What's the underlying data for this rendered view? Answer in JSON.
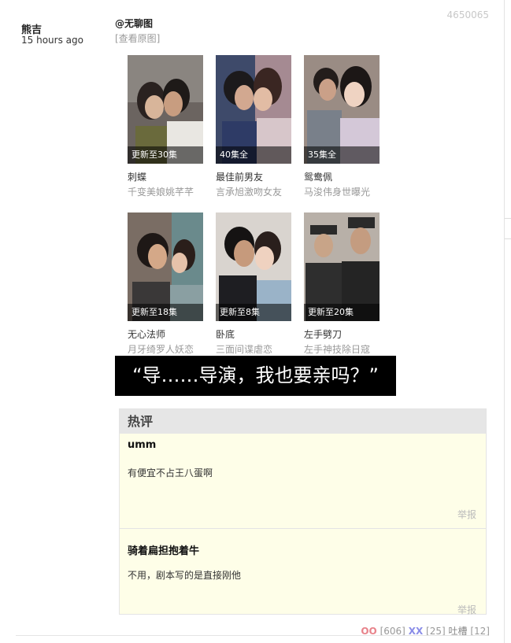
{
  "post": {
    "author": "熊吉",
    "time": "15 hours ago",
    "id": "4650065",
    "mention": "@无聊图",
    "view_original": "[查看原图]"
  },
  "image": {
    "cards": [
      {
        "badge": "更新至30集",
        "title": "刺蝶",
        "subtitle": "千变美娘姚芊芊"
      },
      {
        "badge": "40集全",
        "title": "最佳前男友",
        "subtitle": "言承旭激吻女友"
      },
      {
        "badge": "35集全",
        "title": "鸳鸯佩",
        "subtitle": "马浚伟身世曝光"
      },
      {
        "badge": "更新至18集",
        "title": "无心法师",
        "subtitle": "月牙绮罗人妖恋"
      },
      {
        "badge": "更新至8集",
        "title": "卧底",
        "subtitle": "三面间谍虐恋"
      },
      {
        "badge": "更新至20集",
        "title": "左手劈刀",
        "subtitle": "左手神技除日寇"
      }
    ],
    "caption": "“导……导演，我也要亲吗？”"
  },
  "hot_comments": {
    "title": "热评",
    "items": [
      {
        "user": "umm",
        "text": "有便宜不占王八蛋啊",
        "report": "举报"
      },
      {
        "user": "骑着扁担抱着牛",
        "text": "不用，剧本写的是直接刚他",
        "report": "举报"
      }
    ]
  },
  "votes": {
    "oo_label": "OO",
    "oo_count": "[606]",
    "xx_label": "XX",
    "xx_count": "[25]",
    "tucao_label": "吐槽",
    "tucao_count": "[12]"
  },
  "colors": {
    "oo": "#e8838b",
    "xx": "#8a8de8",
    "hot_bg": "#fefee8",
    "hot_head_bg": "#e6e6e6"
  }
}
